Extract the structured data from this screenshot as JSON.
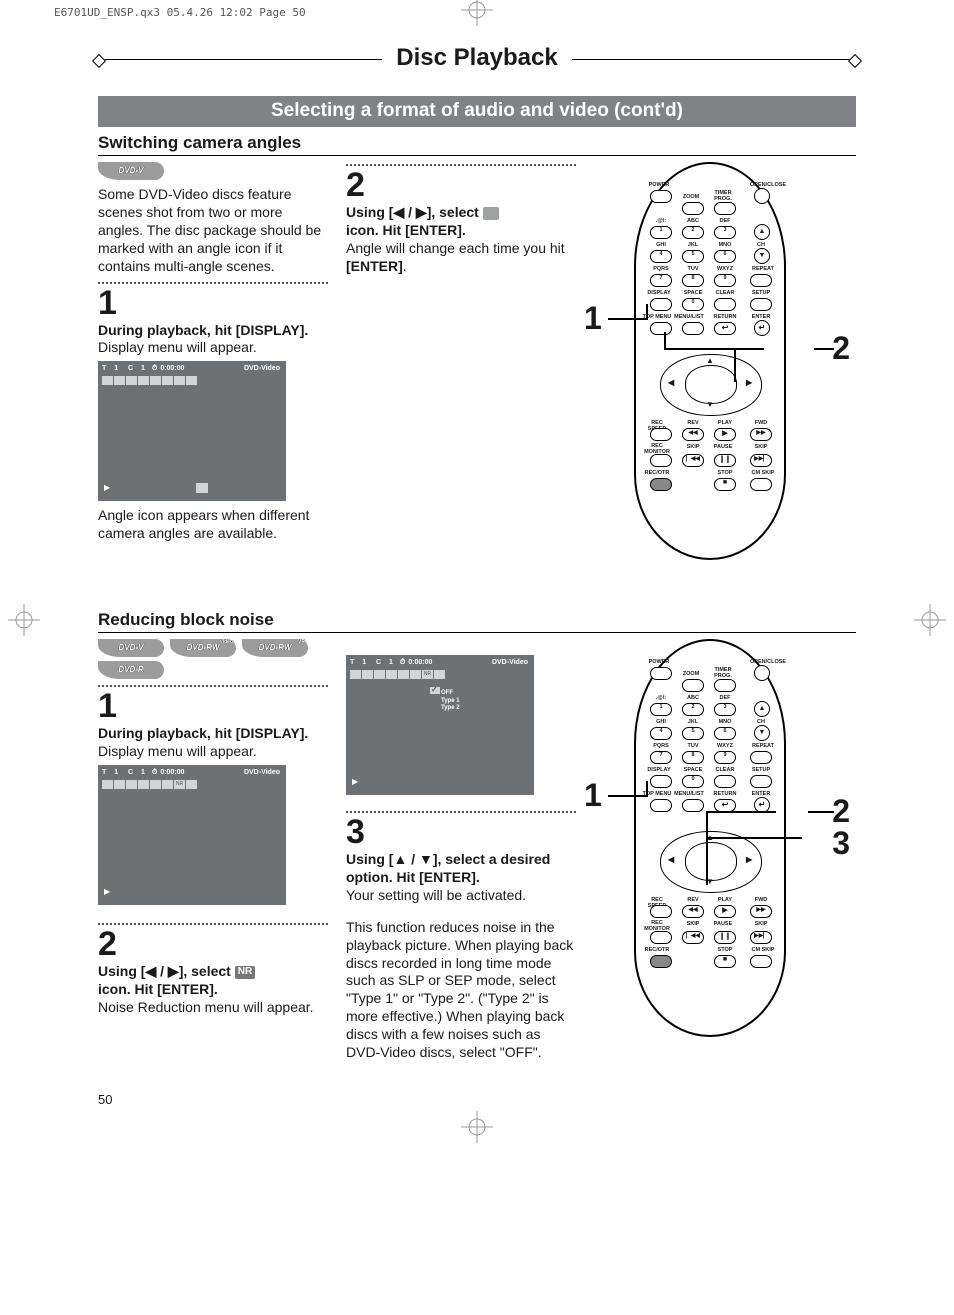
{
  "slug": "E6701UD_ENSP.qx3  05.4.26 12:02  Page 50",
  "page_title": "Disc Playback",
  "subheader": "Selecting a format of audio and video (cont'd)",
  "page_number": "50",
  "section_a": {
    "heading": "Switching camera angles",
    "badges": [
      "DVD-V"
    ],
    "intro": "Some DVD-Video discs feature scenes shot from two or more angles. The disc package should be marked with an angle icon if it contains multi-angle scenes.",
    "step1": {
      "num": "1",
      "head": "During playback, hit [DISPLAY].",
      "body": "Display menu will appear.",
      "caption": "Angle icon appears when different camera angles are available."
    },
    "step2": {
      "num": "2",
      "head_a": "Using [",
      "head_b": " / ",
      "head_c": "], select ",
      "head_d": "icon. Hit [ENTER].",
      "body": "Angle will change each time you hit ",
      "body_b": "[ENTER]",
      "body_c": "."
    },
    "screen": {
      "t": "T",
      "t_v": "1",
      "c": "C",
      "c_v": "1",
      "clock": "0:00:00",
      "label": "DVD-Video"
    },
    "remote_nums": {
      "n1": "1",
      "n2": "2"
    }
  },
  "section_b": {
    "heading": "Reducing block noise",
    "badges": [
      "DVD-V",
      "DVD-RW",
      "DVD-RW",
      "DVD-R"
    ],
    "badge_tags": [
      "",
      "Video",
      "VR",
      ""
    ],
    "step1": {
      "num": "1",
      "head": "During playback, hit [DISPLAY].",
      "body": "Display menu will appear."
    },
    "step2": {
      "num": "2",
      "head_a": "Using [",
      "head_b": " / ",
      "head_c": "], select ",
      "head_d": "icon. Hit [ENTER].",
      "body": "Noise Reduction menu will appear."
    },
    "step3": {
      "num": "3",
      "head": "Using [▲ / ▼], select a desired option. Hit [ENTER].",
      "body1": "Your setting will be activated.",
      "body2": "This function reduces noise in the playback picture. When playing back discs recorded in long time mode such as SLP or SEP mode, select \"Type 1\" or \"Type 2\". (\"Type 2\" is more effective.) When playing back discs with a few noises such as DVD-Video discs, select \"OFF\"."
    },
    "nr_menu": {
      "off": "OFF",
      "t1": "Type 1",
      "t2": "Type 2"
    },
    "screen": {
      "t": "T",
      "t_v": "1",
      "c": "C",
      "c_v": "1",
      "clock": "0:00:00",
      "label": "DVD-Video"
    },
    "remote_nums": {
      "n1": "1",
      "n2": "2",
      "n3": "3"
    }
  },
  "remote": {
    "row0": [
      "POWER",
      "",
      "",
      "OPEN/CLOSE"
    ],
    "row1": [
      "",
      "ZOOM",
      "TIMER PROG.",
      ""
    ],
    "row2": [
      ".@/:",
      "ABC",
      "DEF",
      ""
    ],
    "row3": [
      "1",
      "2",
      "3",
      "▲"
    ],
    "row4": [
      "GHI",
      "JKL",
      "MNO",
      "CH"
    ],
    "row5": [
      "4",
      "5",
      "6",
      "▼"
    ],
    "row6": [
      "PQRS",
      "TUV",
      "WXYZ",
      "REPEAT"
    ],
    "row7": [
      "7",
      "8",
      "9",
      ""
    ],
    "row8": [
      "DISPLAY",
      "SPACE",
      "CLEAR",
      "SETUP"
    ],
    "row9": [
      "",
      "0",
      "",
      ""
    ],
    "row10": [
      "TOP MENU",
      "MENU/LIST",
      "RETURN",
      "ENTER"
    ],
    "row11": [
      "REC SPEED",
      "REV",
      "PLAY",
      "FWD"
    ],
    "row12": [
      "REC MONITOR",
      "SKIP",
      "PAUSE",
      "SKIP"
    ],
    "row13": [
      "REC/OTR",
      "",
      "STOP",
      "CM SKIP"
    ]
  }
}
